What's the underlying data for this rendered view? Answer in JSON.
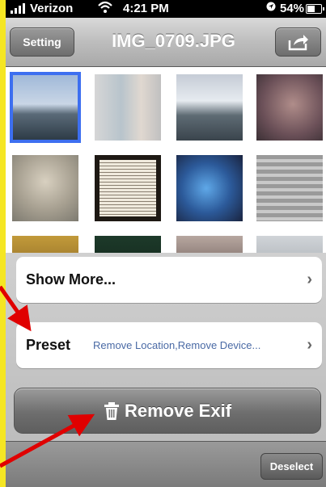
{
  "status_bar": {
    "carrier": "Verizon",
    "time": "4:21 PM",
    "battery": "54%",
    "icons": [
      "signal-icon",
      "wifi-icon",
      "location-icon",
      "battery-icon"
    ]
  },
  "nav": {
    "setting_label": "Setting",
    "title": "IMG_0709.JPG",
    "share_icon": "share-icon"
  },
  "gallery": {
    "selected_index": 0,
    "thumbnail_count": 16
  },
  "sheet": {
    "show_more_label": "Show More...",
    "preset_label": "Preset",
    "preset_value": "Remove Location,Remove Device...",
    "remove_label": "Remove Exif",
    "remove_icon": "trash-icon",
    "deselect_label": "Deselect"
  },
  "colors": {
    "accent_selection": "#3d6ff0",
    "annotation_arrow": "#e00000",
    "preset_value_text": "#4a6aa5",
    "border_frame": "#f5e623"
  }
}
